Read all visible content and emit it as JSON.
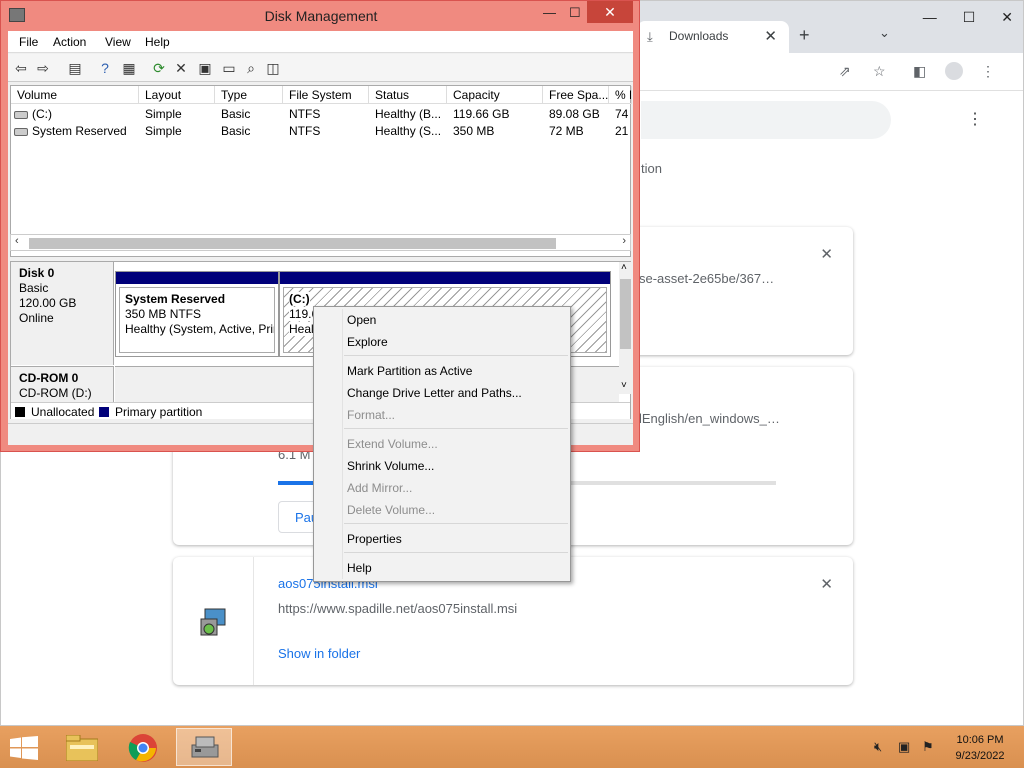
{
  "chrome": {
    "tab_title": "Downloads",
    "tab_close": "✕",
    "new_tab": "+",
    "tab_search": "⌄",
    "frag_tion": "tion",
    "downloads": [
      {
        "name_partial": "se-asset-2e65be/367…",
        "close": "✕"
      },
      {
        "name_partial": "lEnglish/en_windows_…",
        "size_partial": "6.1 M",
        "progress": 0.14,
        "pause_label": "Pau"
      },
      {
        "name": "aos075install.msi",
        "url": "https://www.spadille.net/aos075install.msi",
        "link": "Show in folder",
        "close": "✕"
      }
    ]
  },
  "dm": {
    "title": "Disk Management",
    "window_controls": {
      "minimize": "—",
      "maximize": "☐",
      "close": "✕"
    },
    "menu": [
      "File",
      "Action",
      "View",
      "Help"
    ],
    "columns": [
      "Volume",
      "Layout",
      "Type",
      "File System",
      "Status",
      "Capacity",
      "Free Spa...",
      "% F"
    ],
    "rows": [
      [
        "(C:)",
        "Simple",
        "Basic",
        "NTFS",
        "Healthy (B...",
        "119.66 GB",
        "89.08 GB",
        "74"
      ],
      [
        "System Reserved",
        "Simple",
        "Basic",
        "NTFS",
        "Healthy (S...",
        "350 MB",
        "72 MB",
        "21"
      ]
    ],
    "disk0": {
      "name": "Disk 0",
      "type": "Basic",
      "size": "120.00 GB",
      "state": "Online"
    },
    "sysres": {
      "name": "System Reserved",
      "size": "350 MB NTFS",
      "status": "Healthy (System, Active, Prir"
    },
    "cpart": {
      "name": "(C:)",
      "size_partial": "119.6",
      "status_partial": "Heal"
    },
    "cdrom": {
      "name": "CD-ROM 0",
      "sub": "CD-ROM (D:)"
    },
    "legend": {
      "unallocated": "Unallocated",
      "primary": "Primary partition",
      "unallocated_color": "#000000",
      "primary_color": "#00007a"
    }
  },
  "context_menu": {
    "items": [
      {
        "label": "Open",
        "enabled": true
      },
      {
        "label": "Explore",
        "enabled": true
      },
      {
        "label": "Mark Partition as Active",
        "enabled": true
      },
      {
        "label": "Change Drive Letter and Paths...",
        "enabled": true
      },
      {
        "label": "Format...",
        "enabled": false
      },
      {
        "label": "Extend Volume...",
        "enabled": false
      },
      {
        "label": "Shrink Volume...",
        "enabled": true
      },
      {
        "label": "Add Mirror...",
        "enabled": false
      },
      {
        "label": "Delete Volume...",
        "enabled": false
      },
      {
        "label": "Properties",
        "enabled": true
      },
      {
        "label": "Help",
        "enabled": true
      }
    ]
  },
  "taskbar": {
    "time": "10:06 PM",
    "date": "9/23/2022"
  },
  "colors": {
    "dm_frame": "#f08a80",
    "dm_close": "#c7453a",
    "partition_bar": "#00007a",
    "taskbar": "#d99050"
  }
}
